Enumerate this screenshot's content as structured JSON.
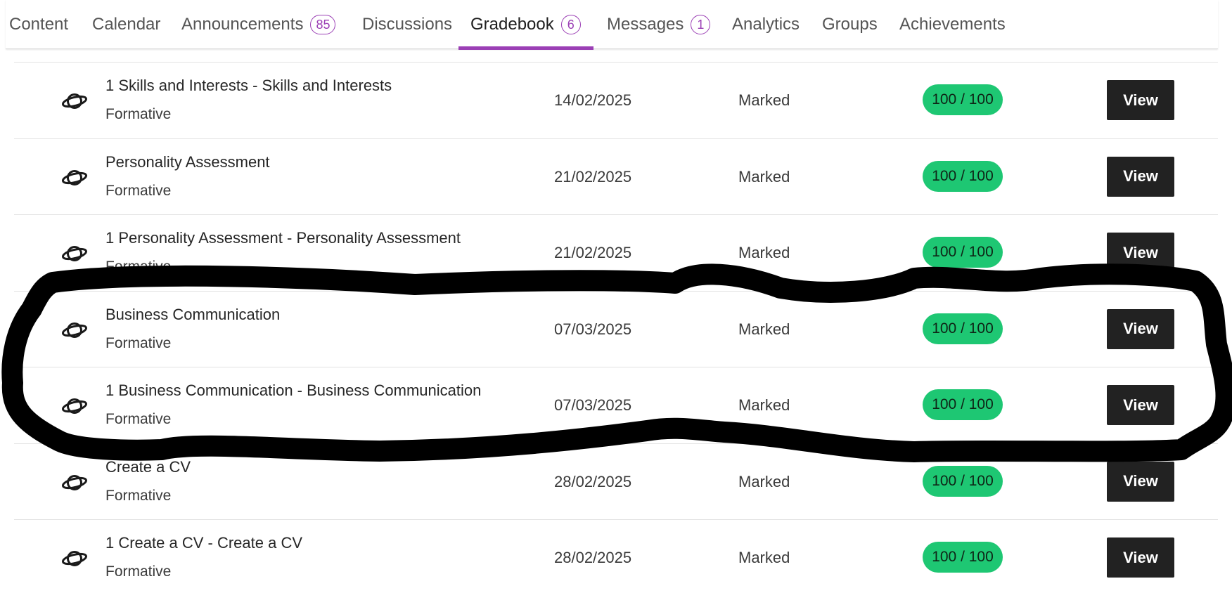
{
  "tabs": [
    {
      "label": "Content",
      "badge": null,
      "active": false
    },
    {
      "label": "Calendar",
      "badge": null,
      "active": false
    },
    {
      "label": "Announcements",
      "badge": "85",
      "active": false
    },
    {
      "label": "Discussions",
      "badge": null,
      "active": false
    },
    {
      "label": "Gradebook",
      "badge": "6",
      "active": true
    },
    {
      "label": "Messages",
      "badge": "1",
      "active": false
    },
    {
      "label": "Analytics",
      "badge": null,
      "active": false
    },
    {
      "label": "Groups",
      "badge": null,
      "active": false
    },
    {
      "label": "Achievements",
      "badge": null,
      "active": false
    }
  ],
  "gradebook": {
    "rows": [
      {
        "title": "1 Skills and Interests - Skills and Interests",
        "type": "Formative",
        "date": "14/02/2025",
        "status": "Marked",
        "score": "100 / 100",
        "action": "View"
      },
      {
        "title": "Personality Assessment",
        "type": "Formative",
        "date": "21/02/2025",
        "status": "Marked",
        "score": "100 / 100",
        "action": "View"
      },
      {
        "title": "1 Personality Assessment - Personality Assessment",
        "type": "Formative",
        "date": "21/02/2025",
        "status": "Marked",
        "score": "100 / 100",
        "action": "View"
      },
      {
        "title": "Business Communication",
        "type": "Formative",
        "date": "07/03/2025",
        "status": "Marked",
        "score": "100 / 100",
        "action": "View"
      },
      {
        "title": "1 Business Communication - Business Communication",
        "type": "Formative",
        "date": "07/03/2025",
        "status": "Marked",
        "score": "100 / 100",
        "action": "View"
      },
      {
        "title": "Create a CV",
        "type": "Formative",
        "date": "28/02/2025",
        "status": "Marked",
        "score": "100 / 100",
        "action": "View"
      },
      {
        "title": "1 Create a CV - Create a CV",
        "type": "Formative",
        "date": "28/02/2025",
        "status": "Marked",
        "score": "100 / 100",
        "action": "View"
      }
    ]
  },
  "icons": {
    "row_icon": "planet-icon"
  },
  "colors": {
    "accent": "#9b3fb5",
    "score_badge": "#1ec773",
    "view_button": "#222222",
    "annotation": "#000000"
  }
}
